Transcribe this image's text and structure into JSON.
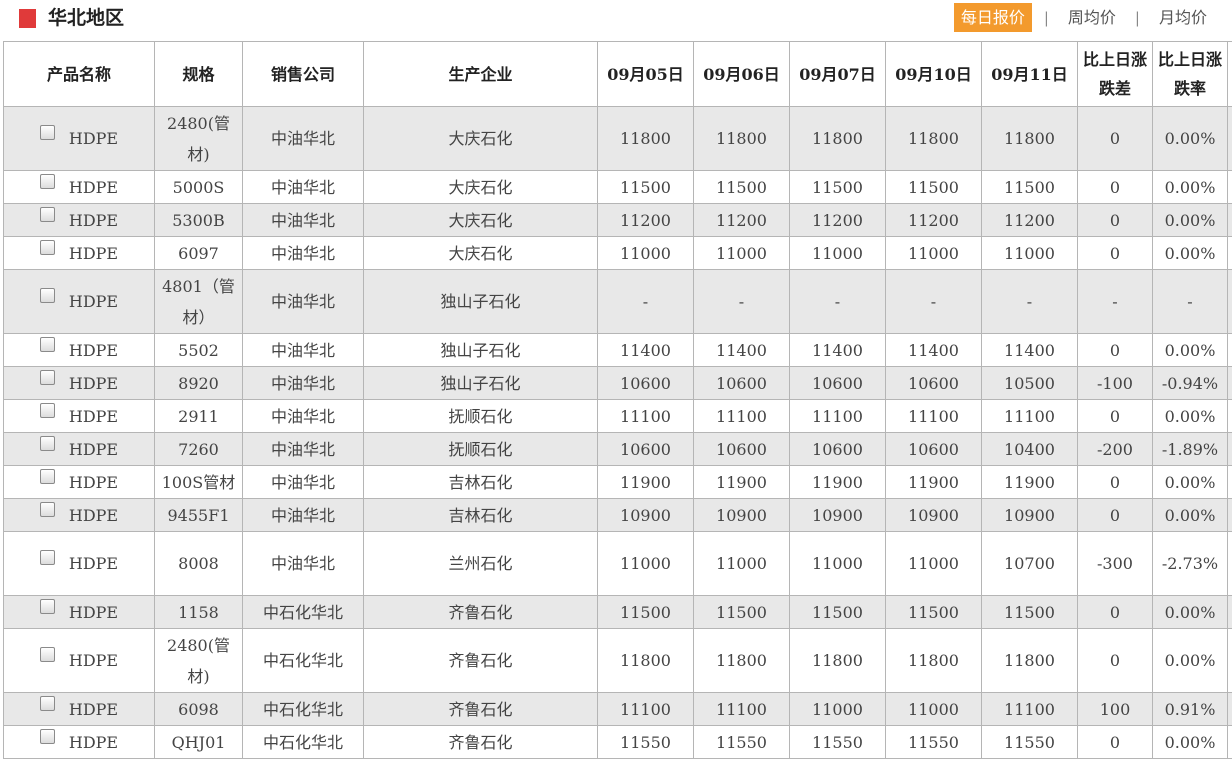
{
  "region": {
    "title": "华北地区",
    "marker_color": "#e03a3a"
  },
  "tabs": [
    {
      "label": "每日报价",
      "active": true
    },
    {
      "label": "周均价",
      "active": false
    },
    {
      "label": "月均价",
      "active": false
    }
  ],
  "tab_separator": "|",
  "colors": {
    "tab_active": "#f39a2d",
    "up": "#e0262b",
    "down": "#2a9a2a",
    "alt_row": "#e8e8e8"
  },
  "table": {
    "headers": [
      "产品名称",
      "规格",
      "销售公司",
      "生产企业",
      "09月05日",
      "09月06日",
      "09月07日",
      "09月10日",
      "09月11日",
      "比上日涨跌差",
      "比上日涨跌率"
    ],
    "rows": [
      {
        "product": "HDPE",
        "spec": "2480(管材)",
        "company": "中油华北",
        "producer": "大庆石化",
        "p1": "11800",
        "p2": "11800",
        "p3": "11800",
        "p4": "11800",
        "p5": "11800",
        "diff": "0",
        "rate": "0.00%",
        "tall": true,
        "alt": true,
        "trend": "flat"
      },
      {
        "product": "HDPE",
        "spec": "5000S",
        "company": "中油华北",
        "producer": "大庆石化",
        "p1": "11500",
        "p2": "11500",
        "p3": "11500",
        "p4": "11500",
        "p5": "11500",
        "diff": "0",
        "rate": "0.00%",
        "tall": false,
        "alt": false,
        "trend": "flat"
      },
      {
        "product": "HDPE",
        "spec": "5300B",
        "company": "中油华北",
        "producer": "大庆石化",
        "p1": "11200",
        "p2": "11200",
        "p3": "11200",
        "p4": "11200",
        "p5": "11200",
        "diff": "0",
        "rate": "0.00%",
        "tall": false,
        "alt": true,
        "trend": "flat"
      },
      {
        "product": "HDPE",
        "spec": "6097",
        "company": "中油华北",
        "producer": "大庆石化",
        "p1": "11000",
        "p2": "11000",
        "p3": "11000",
        "p4": "11000",
        "p5": "11000",
        "diff": "0",
        "rate": "0.00%",
        "tall": false,
        "alt": false,
        "trend": "flat"
      },
      {
        "product": "HDPE",
        "spec": "4801（管材）",
        "company": "中油华北",
        "producer": "独山子石化",
        "p1": "-",
        "p2": "-",
        "p3": "-",
        "p4": "-",
        "p5": "-",
        "diff": "-",
        "rate": "-",
        "tall": true,
        "alt": true,
        "trend": "flat"
      },
      {
        "product": "HDPE",
        "spec": "5502",
        "company": "中油华北",
        "producer": "独山子石化",
        "p1": "11400",
        "p2": "11400",
        "p3": "11400",
        "p4": "11400",
        "p5": "11400",
        "diff": "0",
        "rate": "0.00%",
        "tall": false,
        "alt": false,
        "trend": "flat"
      },
      {
        "product": "HDPE",
        "spec": "8920",
        "company": "中油华北",
        "producer": "独山子石化",
        "p1": "10600",
        "p2": "10600",
        "p3": "10600",
        "p4": "10600",
        "p5": "10500",
        "diff": "-100",
        "rate": "-0.94%",
        "tall": false,
        "alt": true,
        "trend": "down"
      },
      {
        "product": "HDPE",
        "spec": "2911",
        "company": "中油华北",
        "producer": "抚顺石化",
        "p1": "11100",
        "p2": "11100",
        "p3": "11100",
        "p4": "11100",
        "p5": "11100",
        "diff": "0",
        "rate": "0.00%",
        "tall": false,
        "alt": false,
        "trend": "flat"
      },
      {
        "product": "HDPE",
        "spec": "7260",
        "company": "中油华北",
        "producer": "抚顺石化",
        "p1": "10600",
        "p2": "10600",
        "p3": "10600",
        "p4": "10600",
        "p5": "10400",
        "diff": "-200",
        "rate": "-1.89%",
        "tall": false,
        "alt": true,
        "trend": "down"
      },
      {
        "product": "HDPE",
        "spec": "100S管材",
        "company": "中油华北",
        "producer": "吉林石化",
        "p1": "11900",
        "p2": "11900",
        "p3": "11900",
        "p4": "11900",
        "p5": "11900",
        "diff": "0",
        "rate": "0.00%",
        "tall": false,
        "alt": false,
        "trend": "flat"
      },
      {
        "product": "HDPE",
        "spec": "9455F1",
        "company": "中油华北",
        "producer": "吉林石化",
        "p1": "10900",
        "p2": "10900",
        "p3": "10900",
        "p4": "10900",
        "p5": "10900",
        "diff": "0",
        "rate": "0.00%",
        "tall": false,
        "alt": true,
        "trend": "flat"
      },
      {
        "product": "HDPE",
        "spec": "8008",
        "company": "中油华北",
        "producer": "兰州石化",
        "p1": "11000",
        "p2": "11000",
        "p3": "11000",
        "p4": "11000",
        "p5": "10700",
        "diff": "-300",
        "rate": "-2.73%",
        "tall": true,
        "alt": false,
        "trend": "down"
      },
      {
        "product": "HDPE",
        "spec": "1158",
        "company": "中石化华北",
        "producer": "齐鲁石化",
        "p1": "11500",
        "p2": "11500",
        "p3": "11500",
        "p4": "11500",
        "p5": "11500",
        "diff": "0",
        "rate": "0.00%",
        "tall": false,
        "alt": true,
        "trend": "flat"
      },
      {
        "product": "HDPE",
        "spec": "2480(管材)",
        "company": "中石化华北",
        "producer": "齐鲁石化",
        "p1": "11800",
        "p2": "11800",
        "p3": "11800",
        "p4": "11800",
        "p5": "11800",
        "diff": "0",
        "rate": "0.00%",
        "tall": true,
        "alt": false,
        "trend": "flat"
      },
      {
        "product": "HDPE",
        "spec": "6098",
        "company": "中石化华北",
        "producer": "齐鲁石化",
        "p1": "11100",
        "p2": "11100",
        "p3": "11000",
        "p4": "11000",
        "p5": "11100",
        "diff": "100",
        "rate": "0.91%",
        "tall": false,
        "alt": true,
        "trend": "up",
        "p3_trend": "down"
      },
      {
        "product": "HDPE",
        "spec": "QHJ01",
        "company": "中石化华北",
        "producer": "齐鲁石化",
        "p1": "11550",
        "p2": "11550",
        "p3": "11550",
        "p4": "11550",
        "p5": "11550",
        "diff": "0",
        "rate": "0.00%",
        "tall": false,
        "alt": false,
        "trend": "flat"
      }
    ]
  }
}
